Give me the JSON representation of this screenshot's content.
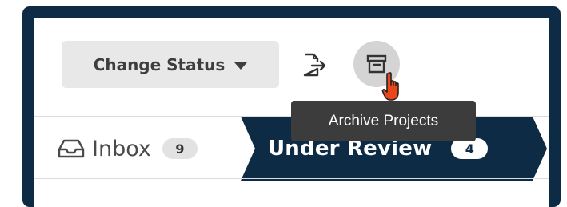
{
  "toolbar": {
    "change_status_label": "Change Status",
    "tooltip": "Archive Projects"
  },
  "icons": {
    "caret": "chevron-down-icon",
    "export": "export-icon",
    "archive": "archive-icon",
    "cursor": "hand-pointer-cursor",
    "inbox": "inbox-icon"
  },
  "tabs": [
    {
      "label": "Inbox",
      "count": "9",
      "active": false
    },
    {
      "label": "Under Review",
      "count": "4",
      "active": true
    }
  ],
  "colors": {
    "frame": "#0d2b45",
    "active_tab": "#0d2b45",
    "tooltip_bg": "#3c3c3c",
    "button_bg": "#e8e8e8",
    "cursor": "#e8471c"
  }
}
